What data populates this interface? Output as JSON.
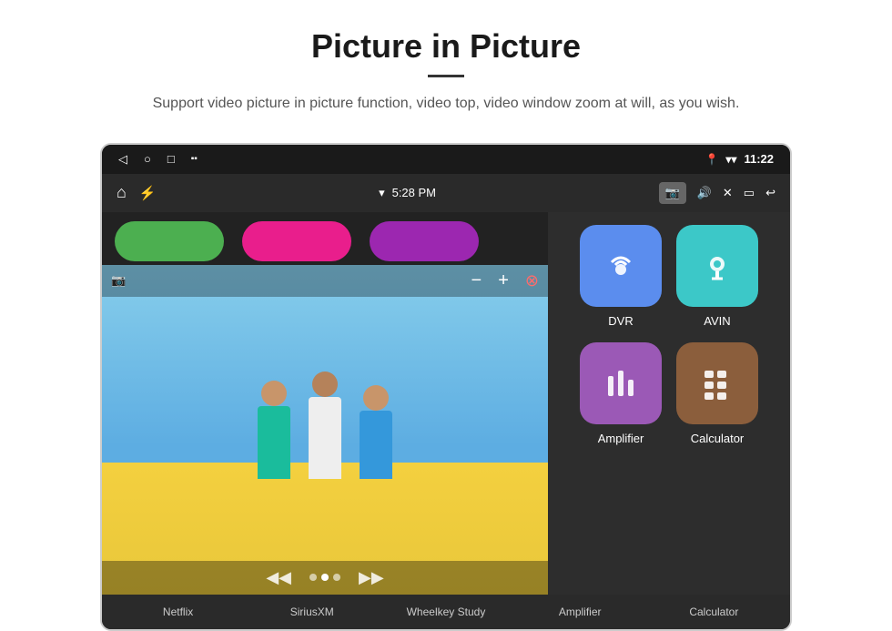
{
  "header": {
    "title": "Picture in Picture",
    "description": "Support video picture in picture function, video top, video window zoom at will, as you wish."
  },
  "status_bar": {
    "left_icons": [
      "◁",
      "○",
      "□",
      "⬛"
    ],
    "time": "11:22",
    "right_icons": [
      "📍",
      "▾"
    ]
  },
  "toolbar": {
    "left_icons": [
      "⌂",
      "⚡"
    ],
    "center_time": "5:28 PM",
    "right_icons": [
      "📷",
      "🔊",
      "✕",
      "▭",
      "↩"
    ]
  },
  "pip_controls": {
    "minus": "−",
    "plus": "+",
    "close": "⊗"
  },
  "video_controls": {
    "prev": "◀◀",
    "play": "▶",
    "next": "▶▶"
  },
  "apps": [
    {
      "id": "dvr",
      "label": "DVR",
      "icon_type": "dvr",
      "color": "icon-blue"
    },
    {
      "id": "avin",
      "label": "AVIN",
      "icon_type": "avin",
      "color": "icon-teal"
    },
    {
      "id": "amplifier",
      "label": "Amplifier",
      "icon_type": "amplifier",
      "color": "icon-purple"
    },
    {
      "id": "calculator",
      "label": "Calculator",
      "icon_type": "calculator",
      "color": "icon-brown"
    }
  ],
  "bottom_app_labels": [
    "Netflix",
    "SiriusXM",
    "Wheelkey Study",
    "Amplifier",
    "Calculator"
  ],
  "top_pills": [
    {
      "color": "pill-green"
    },
    {
      "color": "pill-pink"
    },
    {
      "color": "pill-purple"
    }
  ]
}
